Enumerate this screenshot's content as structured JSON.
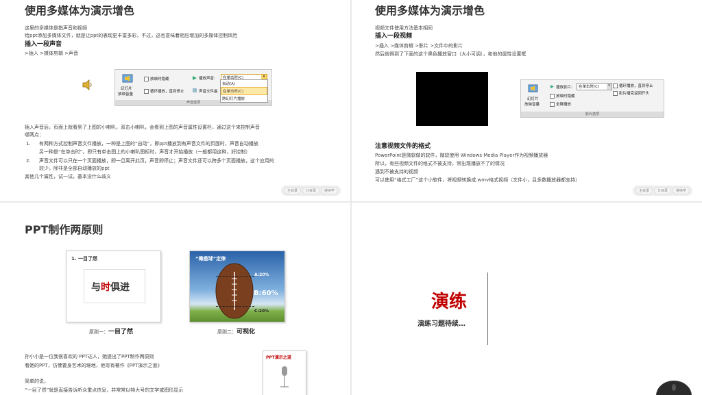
{
  "slide1": {
    "title": "使用多媒体为演示增色",
    "intro1": "这里的多媒体是指声音和视频",
    "intro2": "给ppt添加多媒体文件，就是让ppt的表现更丰富多彩，不过，这也意味着相应增加的多媒体控制风险",
    "heading": "插入一段声音",
    "path": ">插入 >媒体剪辑 >声音",
    "ribbon": {
      "play_label": "幻灯片",
      "play_label2": "放映音量",
      "hide_label": "放映时隐藏",
      "loop_label": "循环播放，直到停止",
      "play_sound_label": "播放声音:",
      "play_sound_value": "在单击时(C)",
      "max_file_label": "声音文件最",
      "group_label": "声音选项",
      "options": [
        "自动(A)",
        "在单击时(C)",
        "跨幻灯片播放"
      ]
    },
    "body": [
      "插入声音后，页面上就看到了上图的小喇叭，双击小喇叭，会看到上图的声音属性设置栏，通过这个来控制声音",
      "哪两点：",
      "有两种方式控制声音文件播放，一种是上图的“自动”，即ppt播放到有声音文件的页面时，声音自动播放",
      "另一种是“在单击时”，即只有单击图上的小喇叭图标时，声音才开始播放（一般都用这种，好控制）",
      "声音文件可以只在一个页面播放，即一旦离开此页，声音即停止；声音文件还可以跨多个页面播放，这个应用的",
      "较少，除非是全部自动播放的ppt",
      "其他几个属性，试一试，基本没什么歧义"
    ],
    "nums": [
      "1.",
      "2."
    ],
    "nav": [
      "主目录",
      "分目录",
      "继续学"
    ]
  },
  "slide2": {
    "title": "使用多媒体为演示增色",
    "intro": "视频文件使用方法基本相同",
    "heading": "插入一段视频",
    "path": ">插入 >媒体剪辑 >影片 >文件中的影片",
    "desc": "然后就得到了下面的这个黑色播放窗口（大小可调），和他的属性设置框",
    "ribbon": {
      "play_label": "幻灯片",
      "play_label2": "放映音量",
      "play_movie_label": "播放影片:",
      "play_movie_value": "在单击时(C)",
      "hide_label": "放映时隐藏",
      "fullscreen_label": "全屏播放",
      "loop_label": "循环播放，直到停止",
      "rewind_label": "影片播完返回开头",
      "group_label": "影片选项"
    },
    "note_heading": "注意视频文件的格式",
    "notes": [
      "PowerPoint是微软做的软件，微软使用 Windows Media Player作为视频播放器",
      "所以，有些视频文件的格式不被支持，常出现播放不了的情况",
      "遇到不被支持的视频",
      "可以使用“格式工厂”这个小软件，将视频转换成.wmv格式视频（文件小，且多数播放器都支持）"
    ],
    "nav": [
      "主目录",
      "分目录",
      "继续学"
    ]
  },
  "slide3": {
    "title": "PPT制作两原则",
    "card1_title": "1. 一目了然",
    "card1_text1": "与",
    "card1_text2": "时",
    "card1_text3": "俱进",
    "card2_title": "“橄榄球”定律",
    "labels": [
      "A:20%",
      "B:60%",
      "C:20%"
    ],
    "caption1_prefix": "原则一：",
    "caption1": "一目了然",
    "caption2_prefix": "原则二：",
    "caption2": "可视化",
    "body": [
      "孙小小是一位我很喜欢的 PPT达人，她提出了PPT制作两原则",
      "看她的PPT，仿佛置身艺术的境地，他写有著作《PPT演示之道》",
      "简单的说，",
      "“一目了然”就是直接告诉听众重点信息，并常常以特大号的文字或图形显示"
    ],
    "book_title": "PPT演示之道"
  },
  "slide4": {
    "title": "演练",
    "subtitle": "演练习题待续…"
  },
  "colors": {
    "accent_red": "#c00000",
    "heading": "#333333"
  }
}
